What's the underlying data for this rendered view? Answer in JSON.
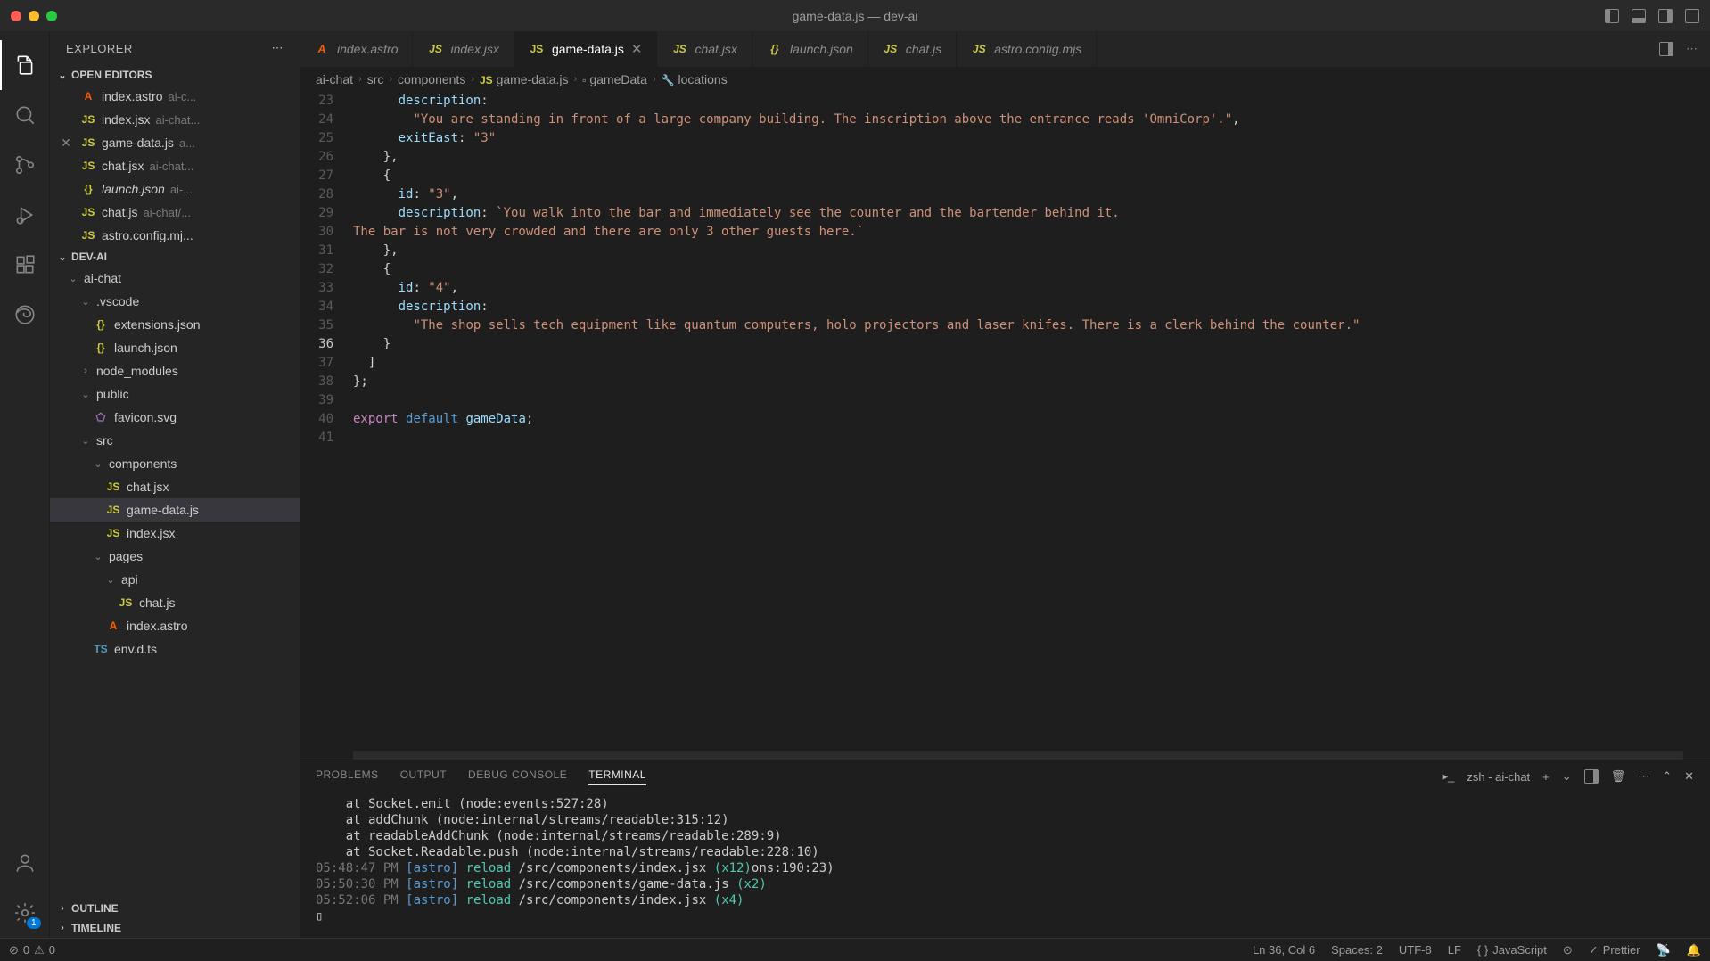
{
  "title": "game-data.js — dev-ai",
  "explorer": {
    "label": "EXPLORER"
  },
  "sections": {
    "open_editors": "OPEN EDITORS",
    "project": "DEV-AI",
    "outline": "OUTLINE",
    "timeline": "TIMELINE"
  },
  "open_editors": [
    {
      "name": "index.astro",
      "dim": "ai-c...",
      "icon": "astro"
    },
    {
      "name": "index.jsx",
      "dim": "ai-chat...",
      "icon": "js"
    },
    {
      "name": "game-data.js",
      "dim": "a...",
      "icon": "js",
      "closeable": true
    },
    {
      "name": "chat.jsx",
      "dim": "ai-chat...",
      "icon": "js"
    },
    {
      "name": "launch.json",
      "dim": "ai-...",
      "icon": "json",
      "italic": true
    },
    {
      "name": "chat.js",
      "dim": "ai-chat/...",
      "icon": "js"
    },
    {
      "name": "astro.config.mj...",
      "dim": "",
      "icon": "js"
    }
  ],
  "tree": [
    {
      "type": "folder",
      "name": "ai-chat",
      "depth": 0,
      "open": true
    },
    {
      "type": "folder",
      "name": ".vscode",
      "depth": 1,
      "open": true
    },
    {
      "type": "file",
      "name": "extensions.json",
      "depth": 2,
      "icon": "json"
    },
    {
      "type": "file",
      "name": "launch.json",
      "depth": 2,
      "icon": "json"
    },
    {
      "type": "folder",
      "name": "node_modules",
      "depth": 1,
      "open": false
    },
    {
      "type": "folder",
      "name": "public",
      "depth": 1,
      "open": true
    },
    {
      "type": "file",
      "name": "favicon.svg",
      "depth": 2,
      "icon": "svg"
    },
    {
      "type": "folder",
      "name": "src",
      "depth": 1,
      "open": true
    },
    {
      "type": "folder",
      "name": "components",
      "depth": 2,
      "open": true
    },
    {
      "type": "file",
      "name": "chat.jsx",
      "depth": 3,
      "icon": "js"
    },
    {
      "type": "file",
      "name": "game-data.js",
      "depth": 3,
      "icon": "js",
      "selected": true
    },
    {
      "type": "file",
      "name": "index.jsx",
      "depth": 3,
      "icon": "js"
    },
    {
      "type": "folder",
      "name": "pages",
      "depth": 2,
      "open": true
    },
    {
      "type": "folder",
      "name": "api",
      "depth": 3,
      "open": true
    },
    {
      "type": "file",
      "name": "chat.js",
      "depth": 4,
      "icon": "js"
    },
    {
      "type": "file",
      "name": "index.astro",
      "depth": 3,
      "icon": "astro"
    },
    {
      "type": "file",
      "name": "env.d.ts",
      "depth": 2,
      "icon": "ts"
    }
  ],
  "tabs": [
    {
      "label": "index.astro",
      "icon": "astro"
    },
    {
      "label": "index.jsx",
      "icon": "js"
    },
    {
      "label": "game-data.js",
      "icon": "js",
      "active": true,
      "close": true
    },
    {
      "label": "chat.jsx",
      "icon": "js"
    },
    {
      "label": "launch.json",
      "icon": "json"
    },
    {
      "label": "chat.js",
      "icon": "js"
    },
    {
      "label": "astro.config.mjs",
      "icon": "js"
    }
  ],
  "breadcrumbs": [
    "ai-chat",
    "src",
    "components",
    "game-data.js",
    "gameData",
    "locations"
  ],
  "code_lines": [
    {
      "n": 23,
      "tokens": [
        [
          "      ",
          ""
        ],
        [
          "description",
          1
        ],
        [
          ":",
          0
        ]
      ]
    },
    {
      "n": 24,
      "tokens": [
        [
          "        ",
          ""
        ],
        [
          "\"You are standing in front of a large company building. The inscription above the entrance reads 'OmniCorp'.\"",
          2
        ],
        [
          ",",
          0
        ]
      ]
    },
    {
      "n": 25,
      "tokens": [
        [
          "      ",
          ""
        ],
        [
          "exitEast",
          1
        ],
        [
          ": ",
          0
        ],
        [
          "\"3\"",
          2
        ]
      ]
    },
    {
      "n": 26,
      "tokens": [
        [
          "    },",
          0
        ]
      ]
    },
    {
      "n": 27,
      "tokens": [
        [
          "    {",
          0
        ]
      ]
    },
    {
      "n": 28,
      "tokens": [
        [
          "      ",
          ""
        ],
        [
          "id",
          1
        ],
        [
          ": ",
          0
        ],
        [
          "\"3\"",
          2
        ],
        [
          ",",
          0
        ]
      ]
    },
    {
      "n": 29,
      "tokens": [
        [
          "      ",
          ""
        ],
        [
          "description",
          1
        ],
        [
          ": ",
          0
        ],
        [
          "`You walk into the bar and immediately see the counter and the bartender behind it.",
          2
        ]
      ]
    },
    {
      "n": 30,
      "tokens": [
        [
          "The bar is not very crowded and there are only 3 other guests here.`",
          2
        ]
      ]
    },
    {
      "n": 31,
      "tokens": [
        [
          "    },",
          0
        ]
      ]
    },
    {
      "n": 32,
      "tokens": [
        [
          "    {",
          0
        ]
      ]
    },
    {
      "n": 33,
      "tokens": [
        [
          "      ",
          ""
        ],
        [
          "id",
          1
        ],
        [
          ": ",
          0
        ],
        [
          "\"4\"",
          2
        ],
        [
          ",",
          0
        ]
      ]
    },
    {
      "n": 34,
      "tokens": [
        [
          "      ",
          ""
        ],
        [
          "description",
          1
        ],
        [
          ":",
          0
        ]
      ]
    },
    {
      "n": 35,
      "tokens": [
        [
          "        ",
          ""
        ],
        [
          "\"The shop sells tech equipment like quantum computers, holo projectors and laser knifes. There is a clerk behind the counter.\"",
          2
        ]
      ]
    },
    {
      "n": 36,
      "tokens": [
        [
          "    }",
          0
        ]
      ],
      "active": true
    },
    {
      "n": 37,
      "tokens": [
        [
          "  ]",
          0
        ]
      ]
    },
    {
      "n": 38,
      "tokens": [
        [
          "};",
          0
        ]
      ]
    },
    {
      "n": 39,
      "tokens": [
        [
          "",
          0
        ]
      ]
    },
    {
      "n": 40,
      "tokens": [
        [
          "export ",
          3
        ],
        [
          "default ",
          4
        ],
        [
          "gameData",
          5
        ],
        [
          ";",
          0
        ]
      ]
    },
    {
      "n": 41,
      "tokens": [
        [
          "",
          0
        ]
      ]
    }
  ],
  "panel_tabs": {
    "problems": "PROBLEMS",
    "output": "OUTPUT",
    "debug": "DEBUG CONSOLE",
    "terminal": "TERMINAL"
  },
  "terminal_title": "zsh - ai-chat",
  "terminal_lines": [
    {
      "plain": "    at Socket.emit (node:events:527:28)"
    },
    {
      "plain": "    at addChunk (node:internal/streams/readable:315:12)"
    },
    {
      "plain": "    at readableAddChunk (node:internal/streams/readable:289:9)"
    },
    {
      "plain": "    at Socket.Readable.push (node:internal/streams/readable:228:10)"
    },
    {
      "time": "05:48:47 PM ",
      "tag": "[astro]",
      "action": " reload",
      "path": " /src/components/index.jsx ",
      "count": "(x12)",
      "tail": "ons:190:23)"
    },
    {
      "time": "05:50:30 PM ",
      "tag": "[astro]",
      "action": " reload",
      "path": " /src/components/game-data.js ",
      "count": "(x2)"
    },
    {
      "time": "05:52:06 PM ",
      "tag": "[astro]",
      "action": " reload",
      "path": " /src/components/index.jsx ",
      "count": "(x4)"
    },
    {
      "plain": "▯"
    }
  ],
  "status": {
    "errors": "0",
    "warnings": "0",
    "cursor": "Ln 36, Col 6",
    "spaces": "Spaces: 2",
    "encoding": "UTF-8",
    "eol": "LF",
    "lang": "JavaScript",
    "prettier": "Prettier"
  },
  "settings_badge": "1"
}
